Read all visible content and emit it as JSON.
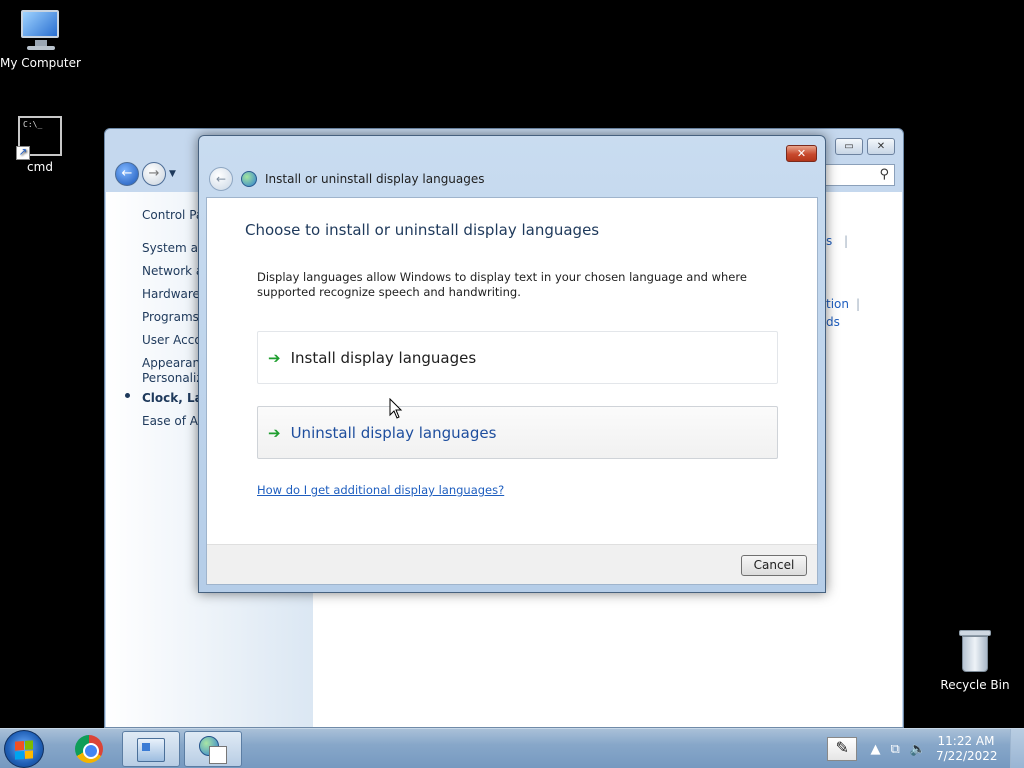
{
  "desktop": {
    "icons": [
      {
        "label": "My Computer"
      },
      {
        "label": "cmd"
      },
      {
        "label": "Recycle Bin"
      }
    ],
    "cmd_glyph": "C:\\_"
  },
  "control_panel": {
    "sidebar": {
      "items": [
        "Control Pa",
        "System and",
        "Network ar",
        "Hardware a",
        "Programs",
        "User Accou",
        "Appearanc",
        "Personaliza",
        "Clock, Lang",
        "Ease of Acc"
      ]
    },
    "right_fragments": [
      "s",
      "tion",
      "ds"
    ]
  },
  "dialog": {
    "title": "Install or uninstall display languages",
    "close_label": "✕",
    "heading": "Choose to install or uninstall display languages",
    "description": "Display languages allow Windows to display text in your chosen language and where supported recognize speech and handwriting.",
    "options": [
      {
        "label": "Install display languages"
      },
      {
        "label": "Uninstall display languages"
      }
    ],
    "help_link": "How do I get additional display languages?",
    "cancel_label": "Cancel"
  },
  "taskbar": {
    "clock_time": "11:22 AM",
    "clock_date": "7/22/2022"
  },
  "icons": {
    "arrow": "➔",
    "back": "←",
    "search": "⚲"
  }
}
